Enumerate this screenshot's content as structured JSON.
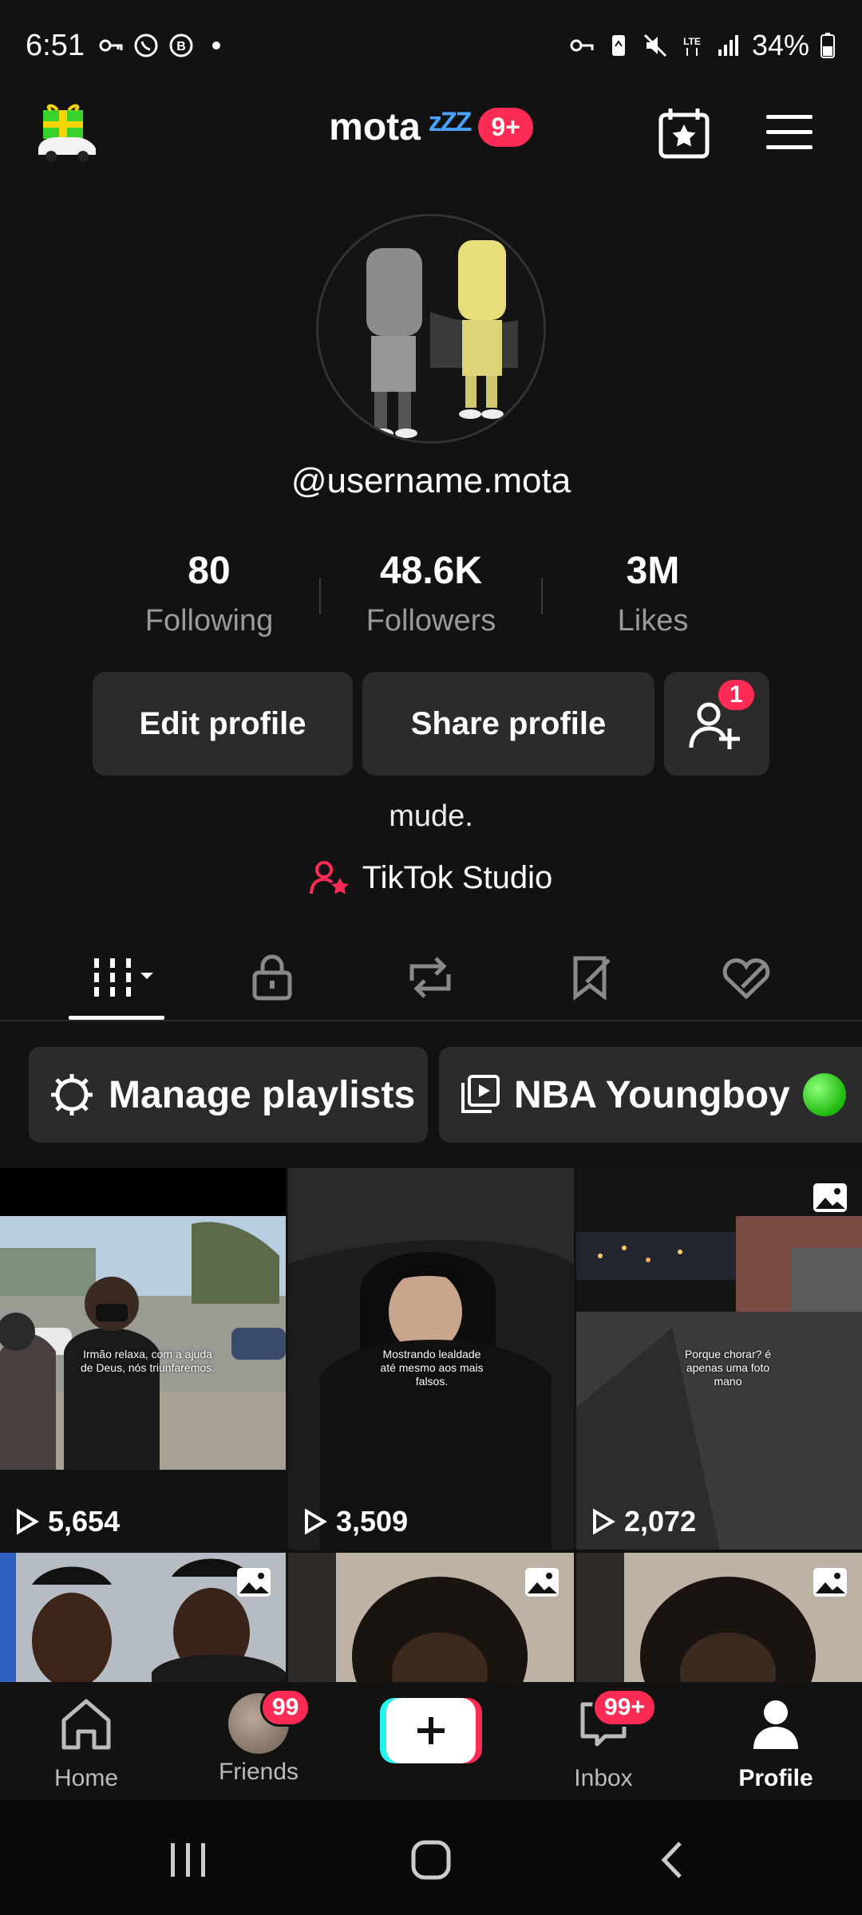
{
  "status_bar": {
    "time": "6:51",
    "battery": "34%"
  },
  "header": {
    "title": "mota",
    "sleep_text": "zZZ",
    "notif_badge": "9+"
  },
  "profile": {
    "username": "@username.mota",
    "stats": [
      {
        "value": "80",
        "label": "Following"
      },
      {
        "value": "48.6K",
        "label": "Followers"
      },
      {
        "value": "3M",
        "label": "Likes"
      }
    ],
    "edit_label": "Edit profile",
    "share_label": "Share profile",
    "add_friend_badge": "1",
    "bio": "mude.",
    "studio_label": "TikTok Studio"
  },
  "playlists": {
    "manage_label": "Manage playlists",
    "playlist_name": "NBA Youngboy"
  },
  "videos": [
    {
      "views": "5,654",
      "caption": "Irmão relaxa, com a ajuda de Deus, nós triunfaremos."
    },
    {
      "views": "3,509",
      "caption": "Mostrando lealdade até mesmo aos mais falsos."
    },
    {
      "views": "2,072",
      "caption": "Porque chorar? é apenas uma foto mano"
    }
  ],
  "bottom_nav": {
    "home": "Home",
    "friends": "Friends",
    "friends_badge": "99",
    "create": "+",
    "inbox": "Inbox",
    "inbox_badge": "99+",
    "profile": "Profile"
  },
  "colors": {
    "background": "#121212",
    "accent": "#fe2c55",
    "button_bg": "#2b2b2b",
    "muted_text": "#9a9a9a"
  }
}
